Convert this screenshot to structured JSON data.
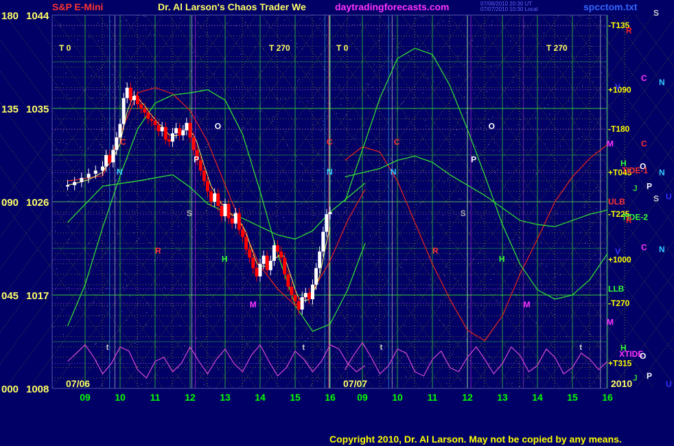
{
  "header": {
    "symbol": "S&P E-Mini",
    "title": "Dr. Al Larson's Chaos Trader We",
    "site": "daytradingforecasts.com",
    "file": "spcctom.txt",
    "stamp1": "07/06/2010 20:30 UT",
    "stamp2": "07/07/2010 10:30 Local"
  },
  "footer": {
    "copyright": "Copyright 2010, Dr. Al Larson. May not be copied by any means.",
    "year": "2010",
    "date1": "07/06",
    "date2": "07/07"
  },
  "colors": {
    "background": "#000066",
    "grid_yellow": "#d6d600",
    "grid_green": "#33cc33",
    "price_white": "#ffffff",
    "price_red": "#ff0000",
    "flux_green": "#33dd33",
    "flux_red": "#dd2222",
    "tide_magenta": "#cc44cc",
    "day_labels": "#00ff00",
    "copyright": "#ffff00"
  },
  "chart_data": {
    "type": "line",
    "title": "S&P E-Mini",
    "left_axis_angle": [
      {
        "label": "180",
        "price": 1044
      },
      {
        "label": "135",
        "price": 1035
      },
      {
        "label": "090",
        "price": 1026
      },
      {
        "label": "045",
        "price": 1017
      },
      {
        "label": "000",
        "price": 1008
      }
    ],
    "ylim": [
      1008,
      1044
    ],
    "x_hour_labels": [
      "09",
      "10",
      "11",
      "12",
      "13",
      "14",
      "15",
      "16",
      "09",
      "10",
      "11",
      "12",
      "13",
      "14",
      "15",
      "16"
    ],
    "right_levels": [
      {
        "label": "-T135",
        "price": 1043.0,
        "color": "#ffff00"
      },
      {
        "label": "+1090",
        "price": 1036.8,
        "color": "#ffff00"
      },
      {
        "label": "-T180",
        "price": 1033.0,
        "color": "#ffff00"
      },
      {
        "label": "+T045",
        "price": 1028.8,
        "color": "#ffff00"
      },
      {
        "label": "ULB",
        "price": 1026.0,
        "color": "#ff3333"
      },
      {
        "label": "-T225",
        "price": 1024.8,
        "color": "#ffff00"
      },
      {
        "label": "+1000",
        "price": 1020.4,
        "color": "#ffff00"
      },
      {
        "label": "LLB",
        "price": 1017.6,
        "color": "#33ff33"
      },
      {
        "label": "-T270",
        "price": 1016.2,
        "color": "#ffff00"
      },
      {
        "label": "+T315",
        "price": 1010.4,
        "color": "#ffff00"
      }
    ],
    "right_symbols": [
      {
        "label": "S",
        "price": 1044.2,
        "color": "#cccccc"
      },
      {
        "label": "R",
        "price": 1042.5,
        "color": "#ff2222"
      },
      {
        "label": "C",
        "price": 1037.9,
        "color": "#ff33ff"
      },
      {
        "label": "N",
        "price": 1037.5,
        "color": "#33ccff"
      },
      {
        "label": "V",
        "price": 1037.1,
        "color": "#3333ff"
      },
      {
        "label": "C",
        "price": 1031.6,
        "color": "#ff3333"
      },
      {
        "label": "M",
        "price": 1031.6,
        "color": "#ff33ff"
      },
      {
        "label": "H",
        "price": 1029.7,
        "color": "#33ff33"
      },
      {
        "label": "O",
        "price": 1029.4,
        "color": "#ffffff"
      },
      {
        "label": "TIDE-1",
        "price": 1029.0,
        "color": "#ff3333"
      },
      {
        "label": "N",
        "price": 1028.8,
        "color": "#33ccff"
      },
      {
        "label": "P",
        "price": 1027.5,
        "color": "#ffffff"
      },
      {
        "label": "J",
        "price": 1027.3,
        "color": "#33cc33"
      },
      {
        "label": "S",
        "price": 1026.3,
        "color": "#cccccc"
      },
      {
        "label": "U",
        "price": 1026.5,
        "color": "#3333ff"
      },
      {
        "label": "TIDE-2",
        "price": 1024.5,
        "color": "#33ff33"
      },
      {
        "label": "R",
        "price": 1024.2,
        "color": "#ff2222"
      },
      {
        "label": "C",
        "price": 1021.6,
        "color": "#ff33ff"
      },
      {
        "label": "N",
        "price": 1021.4,
        "color": "#33ccff"
      },
      {
        "label": "V",
        "price": 1021.2,
        "color": "#3333ff"
      },
      {
        "label": "M",
        "price": 1014.4,
        "color": "#ff33ff"
      },
      {
        "label": "H",
        "price": 1011.9,
        "color": "#33ff33"
      },
      {
        "label": "XTIDE",
        "price": 1011.3,
        "color": "#ff33ff"
      },
      {
        "label": "O",
        "price": 1011.1,
        "color": "#ffffff"
      },
      {
        "label": "J",
        "price": 1009.0,
        "color": "#33cc33"
      },
      {
        "label": "P",
        "price": 1009.2,
        "color": "#ffffff"
      },
      {
        "label": "U",
        "price": 1008.4,
        "color": "#3333ff"
      }
    ],
    "t_markers": [
      {
        "label": "T 0",
        "x_hour": 9.0
      },
      {
        "label": "T 270",
        "x_hour": 15.0
      },
      {
        "label": "T 0",
        "x_hour": 33.0
      },
      {
        "label": "T 270",
        "x_hour": 39.0
      }
    ],
    "in_chart_markers": [
      {
        "label": "C",
        "x_hour": 10.0,
        "price": 1031.5,
        "color": "#ff3333"
      },
      {
        "label": "N",
        "x_hour": 9.9,
        "price": 1028.6,
        "color": "#33ccff"
      },
      {
        "label": "O",
        "x_hour": 12.7,
        "price": 1033.0,
        "color": "#ffffff"
      },
      {
        "label": "P",
        "x_hour": 12.1,
        "price": 1029.8,
        "color": "#ffffff"
      },
      {
        "label": "S",
        "x_hour": 11.9,
        "price": 1024.6,
        "color": "#aaaaaa"
      },
      {
        "label": "R",
        "x_hour": 11.0,
        "price": 1021.0,
        "color": "#ff3333"
      },
      {
        "label": "H",
        "x_hour": 12.9,
        "price": 1020.2,
        "color": "#33ff33"
      },
      {
        "label": "M",
        "x_hour": 13.7,
        "price": 1015.8,
        "color": "#ff33ff"
      },
      {
        "label": "t",
        "x_hour": 9.6,
        "price": 1011.7,
        "color": "#cccccc"
      },
      {
        "label": "t",
        "x_hour": 15.2,
        "price": 1011.7,
        "color": "#cccccc"
      },
      {
        "label": "C",
        "x_hour": 15.9,
        "price": 1031.5,
        "color": "#ff3333"
      },
      {
        "label": "N",
        "x_hour": 15.9,
        "price": 1028.6,
        "color": "#33ccff"
      },
      {
        "label": "C",
        "x_hour": 33.9,
        "price": 1031.5,
        "color": "#ff3333"
      },
      {
        "label": "N",
        "x_hour": 33.8,
        "price": 1028.6,
        "color": "#33ccff"
      },
      {
        "label": "O",
        "x_hour": 36.6,
        "price": 1033.0,
        "color": "#ffffff"
      },
      {
        "label": "P",
        "x_hour": 36.1,
        "price": 1029.8,
        "color": "#ffffff"
      },
      {
        "label": "S",
        "x_hour": 35.8,
        "price": 1024.6,
        "color": "#aaaaaa"
      },
      {
        "label": "R",
        "x_hour": 35.0,
        "price": 1021.0,
        "color": "#ff3333"
      },
      {
        "label": "H",
        "x_hour": 36.9,
        "price": 1020.2,
        "color": "#33ff33"
      },
      {
        "label": "M",
        "x_hour": 37.6,
        "price": 1015.8,
        "color": "#ff33ff"
      },
      {
        "label": "t",
        "x_hour": 33.5,
        "price": 1011.7,
        "color": "#cccccc"
      },
      {
        "label": "t",
        "x_hour": 39.2,
        "price": 1011.7,
        "color": "#cccccc"
      }
    ],
    "series": [
      {
        "type": "candlestick",
        "x_hour": [
          8.5,
          8.7,
          8.9,
          9.1,
          9.3,
          9.5,
          9.6,
          9.7,
          9.8,
          9.9,
          10.0,
          10.1,
          10.2,
          10.3,
          10.4,
          10.5,
          10.6,
          10.7,
          10.8,
          10.9,
          11.0,
          11.1,
          11.2,
          11.3,
          11.4,
          11.5,
          11.6,
          11.7,
          11.8,
          11.9,
          12.0,
          12.1,
          12.2,
          12.3,
          12.4,
          12.5,
          12.6,
          12.7,
          12.8,
          12.9,
          13.0,
          13.1,
          13.2,
          13.3,
          13.4,
          13.5,
          13.6,
          13.7,
          13.8,
          13.9,
          14.0,
          14.1,
          14.2,
          14.3,
          14.4,
          14.5,
          14.6,
          14.7,
          14.8,
          14.9,
          15.0,
          15.1,
          15.2,
          15.3,
          15.4,
          15.5,
          15.6,
          15.7,
          15.8,
          15.9,
          16.0
        ],
        "price": [
          1027.6,
          1027.9,
          1028.3,
          1028.7,
          1029.0,
          1029.4,
          1030.5,
          1029.8,
          1031.0,
          1032.2,
          1033.5,
          1036.0,
          1037.0,
          1035.8,
          1036.2,
          1035.4,
          1035.0,
          1034.6,
          1034.0,
          1033.8,
          1033.4,
          1032.8,
          1033.2,
          1032.0,
          1031.8,
          1032.6,
          1033.1,
          1032.4,
          1032.9,
          1033.6,
          1032.2,
          1031.0,
          1030.0,
          1029.0,
          1028.0,
          1027.0,
          1026.0,
          1026.8,
          1025.6,
          1024.6,
          1025.8,
          1024.4,
          1023.9,
          1024.9,
          1023.3,
          1022.6,
          1021.4,
          1020.6,
          1019.6,
          1018.8,
          1020.0,
          1020.8,
          1019.4,
          1020.3,
          1021.8,
          1021.2,
          1020.6,
          1019.0,
          1017.8,
          1017.0,
          1016.4,
          1015.6,
          1016.8,
          1017.2,
          1016.6,
          1018.0,
          1019.6,
          1021.2,
          1023.1,
          1024.8,
          1025.0
        ],
        "up_color": "#ffffff",
        "down_color": "#ff0000"
      },
      {
        "type": "line",
        "color": "#dd2222",
        "x_hour": [
          8.5,
          9.5,
          10.5,
          11.0,
          11.5,
          12.0,
          12.5,
          13.0,
          13.5,
          14.0,
          14.5,
          15.0,
          15.5,
          16.0,
          16.5,
          17.0,
          32.5,
          33.0,
          33.5,
          34.0,
          34.5,
          35.0,
          35.5,
          36.0,
          36.5,
          37.0,
          37.5,
          38.0,
          38.5,
          39.0,
          39.5,
          40.0
        ],
        "price": [
          1028.0,
          1028.5,
          1036.5,
          1037.0,
          1036.4,
          1034.8,
          1031.8,
          1027.6,
          1023.5,
          1019.8,
          1017.6,
          1016.0,
          1017.4,
          1020.3,
          1024.2,
          1027.2,
          1030.0,
          1031.3,
          1030.8,
          1028.0,
          1024.0,
          1020.0,
          1016.6,
          1013.6,
          1012.6,
          1015.0,
          1019.0,
          1022.4,
          1026.0,
          1028.4,
          1030.2,
          1031.5
        ]
      },
      {
        "type": "line",
        "color": "#33dd33",
        "x_hour": [
          8.5,
          9.0,
          9.5,
          10.0,
          10.5,
          11.0,
          11.5,
          12.0,
          12.5,
          13.0,
          13.5,
          14.0,
          14.5,
          15.0,
          15.5,
          16.0,
          16.5,
          17.0,
          32.5,
          33.0,
          33.5,
          34.0,
          34.5,
          35.0,
          35.5,
          36.0,
          36.5,
          37.0,
          37.5,
          38.0,
          38.5,
          39.0,
          39.5,
          40.0
        ],
        "price": [
          1014.0,
          1018.0,
          1023.5,
          1028.5,
          1033.0,
          1035.5,
          1036.3,
          1036.5,
          1036.8,
          1035.8,
          1032.5,
          1027.0,
          1021.0,
          1016.0,
          1013.5,
          1014.2,
          1017.5,
          1022.0,
          1026.0,
          1031.0,
          1036.0,
          1039.8,
          1040.8,
          1040.2,
          1037.2,
          1033.0,
          1028.5,
          1023.8,
          1020.0,
          1017.5,
          1016.6,
          1017.0,
          1018.5,
          1021.0
        ]
      },
      {
        "type": "line",
        "color": "#33dd33",
        "x_hour": [
          8.5,
          9.5,
          10.5,
          11.0,
          11.5,
          12.0,
          12.5,
          13.0,
          13.5,
          14.0,
          14.5,
          15.0,
          15.5,
          16.0,
          16.5,
          17.0,
          32.5,
          33.0,
          33.5,
          34.0,
          34.5,
          35.0,
          35.5,
          36.0,
          36.5,
          37.0,
          37.5,
          38.0,
          38.5,
          39.0,
          39.5,
          40.0
        ],
        "price": [
          1024.0,
          1027.5,
          1028.0,
          1028.3,
          1028.6,
          1027.4,
          1025.8,
          1025.0,
          1024.4,
          1023.6,
          1022.8,
          1022.4,
          1023.2,
          1025.0,
          1026.4,
          1027.8,
          1028.4,
          1028.8,
          1029.2,
          1030.0,
          1030.4,
          1029.8,
          1028.6,
          1027.6,
          1026.6,
          1025.4,
          1024.2,
          1023.8,
          1023.6,
          1024.2,
          1024.8,
          1025.2
        ]
      },
      {
        "type": "line",
        "color": "#cc44cc",
        "x_hour": [
          8.5,
          8.75,
          9.0,
          9.25,
          9.5,
          9.75,
          10.0,
          10.25,
          10.5,
          10.75,
          11.0,
          11.25,
          11.5,
          11.75,
          12.0,
          12.25,
          12.5,
          12.75,
          13.0,
          13.25,
          13.5,
          13.75,
          14.0,
          14.25,
          14.5,
          14.75,
          15.0,
          15.25,
          15.5,
          15.75,
          16.0,
          16.25,
          16.5,
          16.75,
          17.0,
          32.5,
          32.75,
          33.0,
          33.25,
          33.5,
          33.75,
          34.0,
          34.25,
          34.5,
          34.75,
          35.0,
          35.25,
          35.5,
          35.75,
          36.0,
          36.25,
          36.5,
          36.75,
          37.0,
          37.25,
          37.5,
          37.75,
          38.0,
          38.25,
          38.5,
          38.75,
          39.0,
          39.25,
          39.5,
          39.75,
          40.0
        ],
        "price": [
          1010.6,
          1011.4,
          1012.2,
          1011.0,
          1009.4,
          1010.4,
          1012.0,
          1011.6,
          1009.8,
          1009.0,
          1010.6,
          1011.0,
          1009.6,
          1010.4,
          1012.0,
          1010.6,
          1009.4,
          1010.8,
          1011.8,
          1010.4,
          1009.6,
          1011.2,
          1012.2,
          1010.6,
          1009.2,
          1010.0,
          1011.6,
          1010.8,
          1009.6,
          1010.6,
          1012.2,
          1011.8,
          1010.4,
          1009.6,
          1010.2,
          1009.8,
          1011.2,
          1012.4,
          1011.0,
          1009.4,
          1010.2,
          1011.8,
          1011.4,
          1009.6,
          1009.2,
          1010.8,
          1011.6,
          1010.0,
          1009.6,
          1011.0,
          1012.0,
          1010.8,
          1009.4,
          1010.4,
          1012.0,
          1011.2,
          1009.6,
          1010.2,
          1011.8,
          1011.0,
          1009.4,
          1010.0,
          1011.4,
          1010.8,
          1009.8,
          1010.6
        ]
      }
    ],
    "grid": true,
    "legend": "none"
  }
}
